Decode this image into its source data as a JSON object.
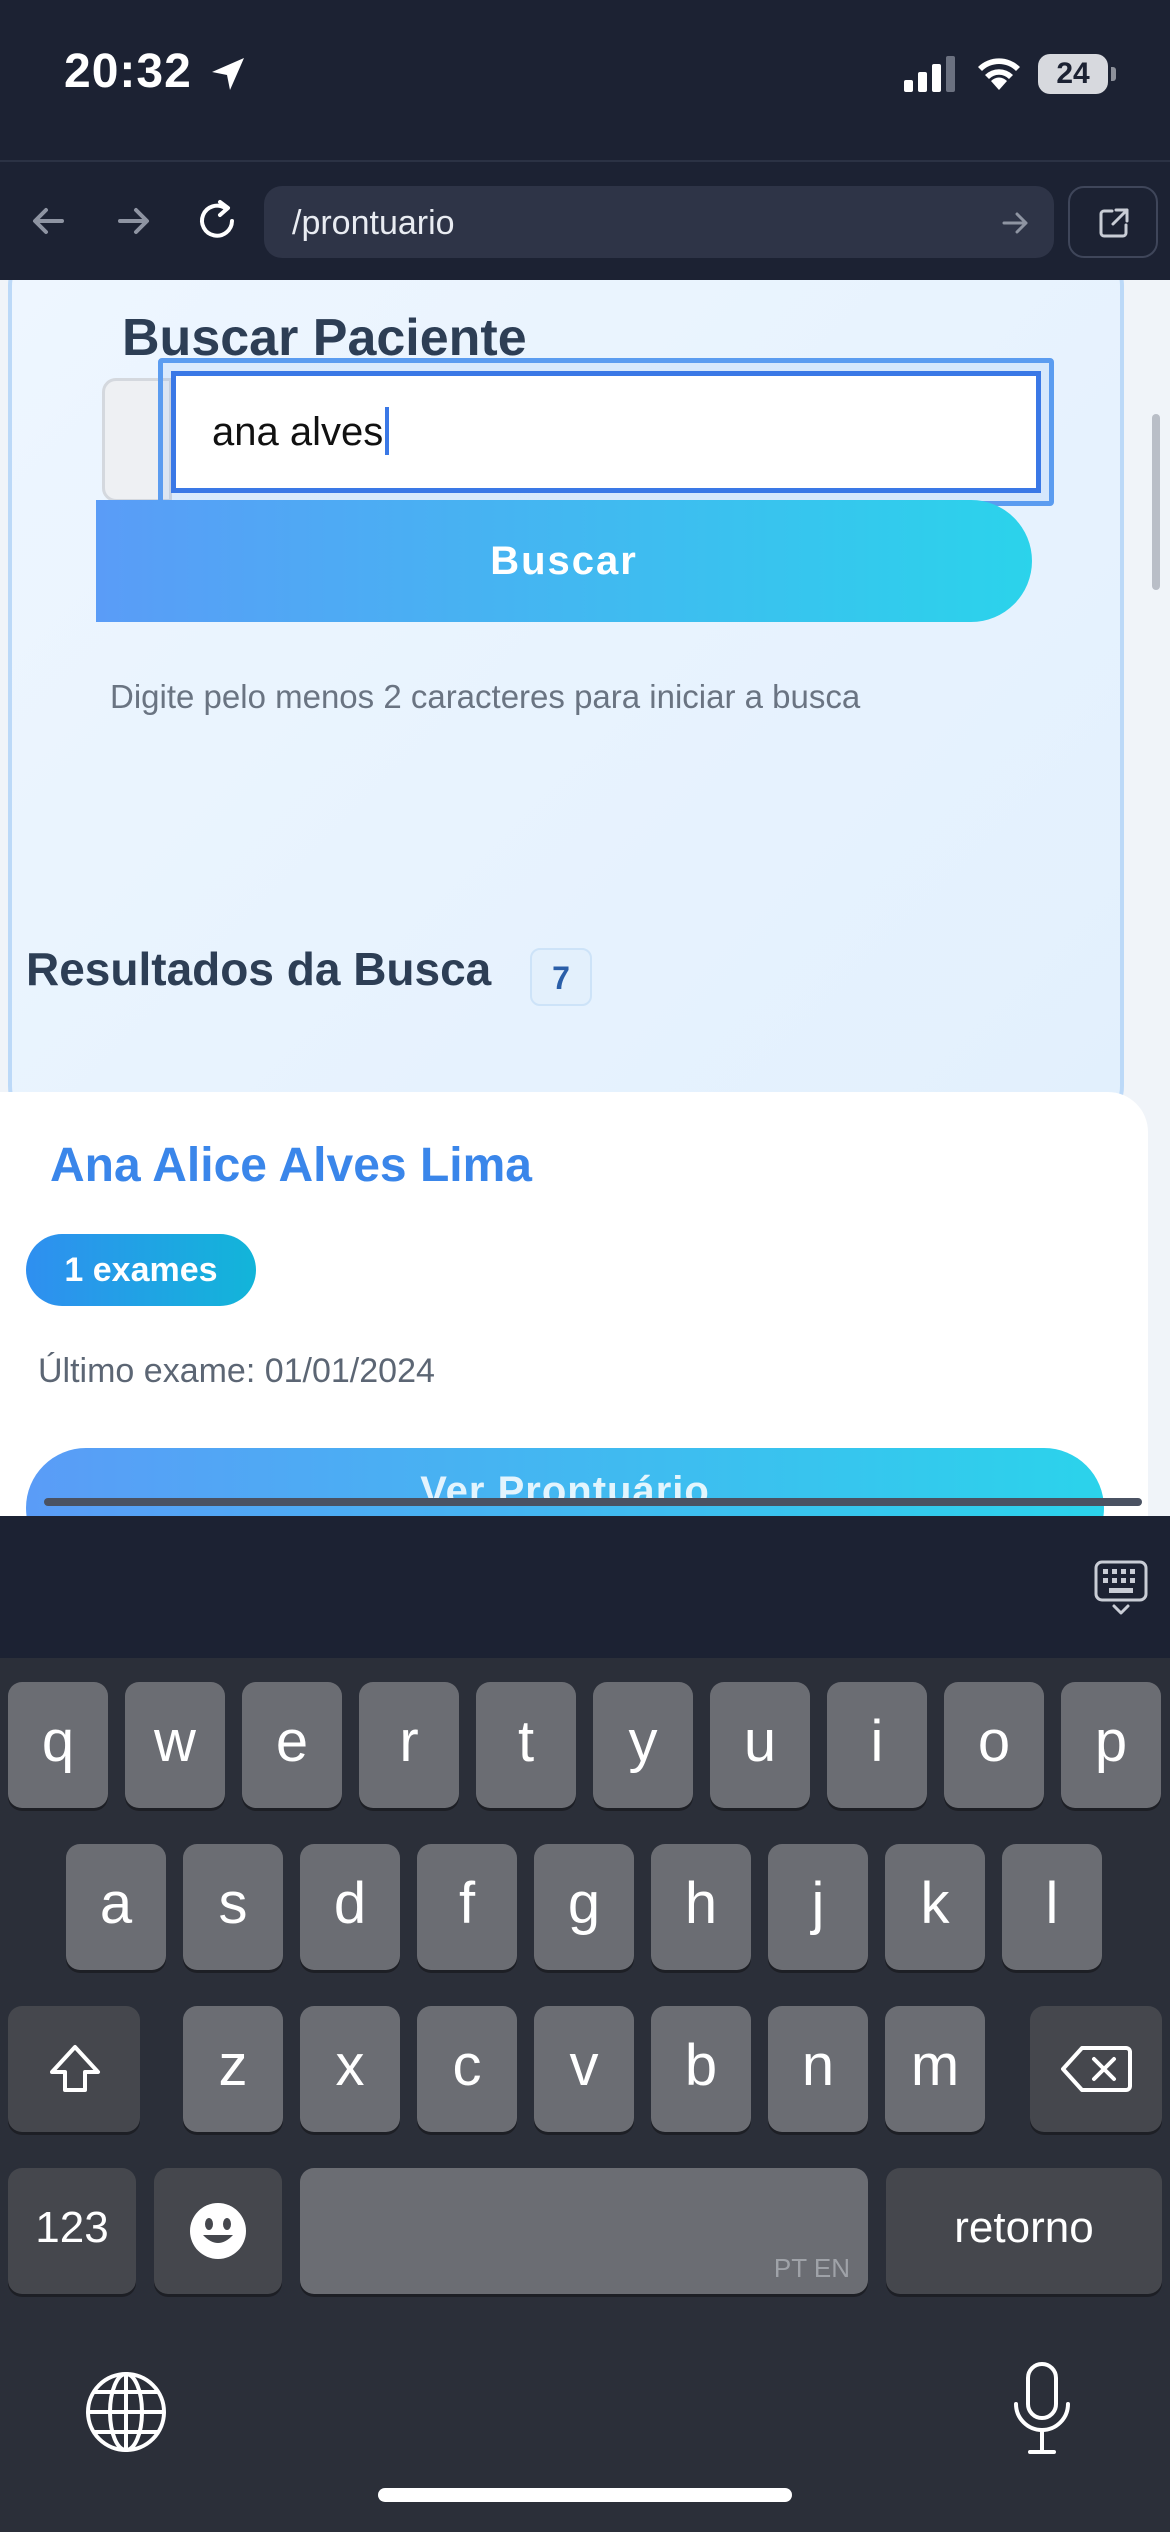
{
  "status_bar": {
    "time": "20:32",
    "battery": "24"
  },
  "browser": {
    "url": "/prontuario"
  },
  "search": {
    "title": "Buscar Paciente",
    "input_value": "ana alves",
    "button_label": "Buscar",
    "hint": "Digite pelo menos 2 caracteres para iniciar a busca"
  },
  "results": {
    "title": "Resultados da Busca",
    "count": "7",
    "items": [
      {
        "name": "Ana Alice Alves Lima",
        "exams_badge": "1 exames",
        "last_exam": "Último exame: 01/01/2024",
        "button_label": "Ver Prontuário"
      }
    ]
  },
  "keyboard": {
    "row1": [
      "q",
      "w",
      "e",
      "r",
      "t",
      "y",
      "u",
      "i",
      "o",
      "p"
    ],
    "row2": [
      "a",
      "s",
      "d",
      "f",
      "g",
      "h",
      "j",
      "k",
      "l"
    ],
    "row3": [
      "z",
      "x",
      "c",
      "v",
      "b",
      "n",
      "m"
    ],
    "numbers_label": "123",
    "space_lang": "PT EN",
    "return_label": "retorno"
  }
}
